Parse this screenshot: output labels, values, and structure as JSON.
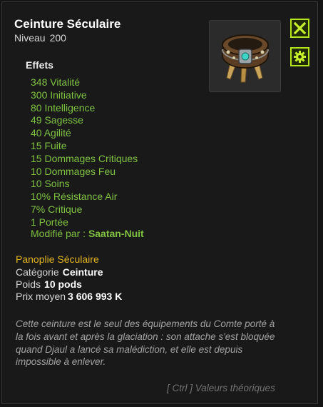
{
  "item": {
    "name": "Ceinture Séculaire",
    "level_label": "Niveau",
    "level_value": "200"
  },
  "buttons": {
    "close_icon": "close-x-icon",
    "settings_icon": "gear-icon"
  },
  "effects": {
    "title": "Effets",
    "lines": [
      "348 Vitalité",
      "300 Initiative",
      "80 Intelligence",
      "49 Sagesse",
      "40 Agilité",
      "15 Fuite",
      "15 Dommages Critiques",
      "10 Dommages Feu",
      "10 Soins",
      "10% Résistance Air",
      "7% Critique",
      "1 Portée"
    ],
    "modified_label": "Modifié par :",
    "modified_by": "Saatan-Nuit"
  },
  "details": {
    "set_name": "Panoplie Séculaire",
    "category_label": "Catégorie",
    "category_value": "Ceinture",
    "weight_label": "Poids",
    "weight_value": "10 pods",
    "price_label": "Prix moyen",
    "price_value": "3 606 993 K"
  },
  "description": "Cette ceinture est le seul des équipements du Comte porté à la fois avant et après la glaciation : son attache s'est bloquée quand Djaul a lancé sa malédiction, et elle est depuis impossible à enlever.",
  "footer": "[ Ctrl ] Valeurs théoriques",
  "colors": {
    "effect_green": "#7fc242",
    "set_gold": "#e3b521",
    "button_border": "#b6e61c"
  }
}
